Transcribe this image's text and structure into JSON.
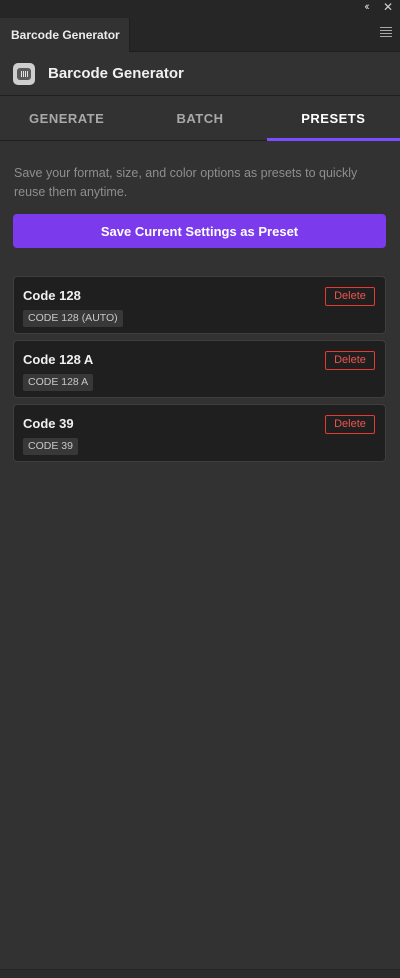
{
  "window": {
    "collapse_glyph": "‹‹",
    "close_glyph": "✕",
    "panel_tab_label": "Barcode Generator"
  },
  "header": {
    "title": "Barcode Generator",
    "logo_icon": "barcode-icon"
  },
  "tabs": [
    {
      "label": "GENERATE",
      "active": false
    },
    {
      "label": "BATCH",
      "active": false
    },
    {
      "label": "PRESETS",
      "active": true
    }
  ],
  "presets_page": {
    "description": "Save your format, size, and color options as presets to quickly reuse them anytime.",
    "save_button_label": "Save Current Settings as Preset",
    "delete_label": "Delete",
    "items": [
      {
        "name": "Code 128",
        "tag": "CODE 128 (AUTO)"
      },
      {
        "name": "Code 128 A",
        "tag": "CODE 128 A"
      },
      {
        "name": "Code 39",
        "tag": "CODE 39"
      }
    ]
  },
  "colors": {
    "accent": "#7c3aed",
    "tab_underline": "#7c4dff",
    "delete": "#e53935",
    "background": "#323232"
  }
}
